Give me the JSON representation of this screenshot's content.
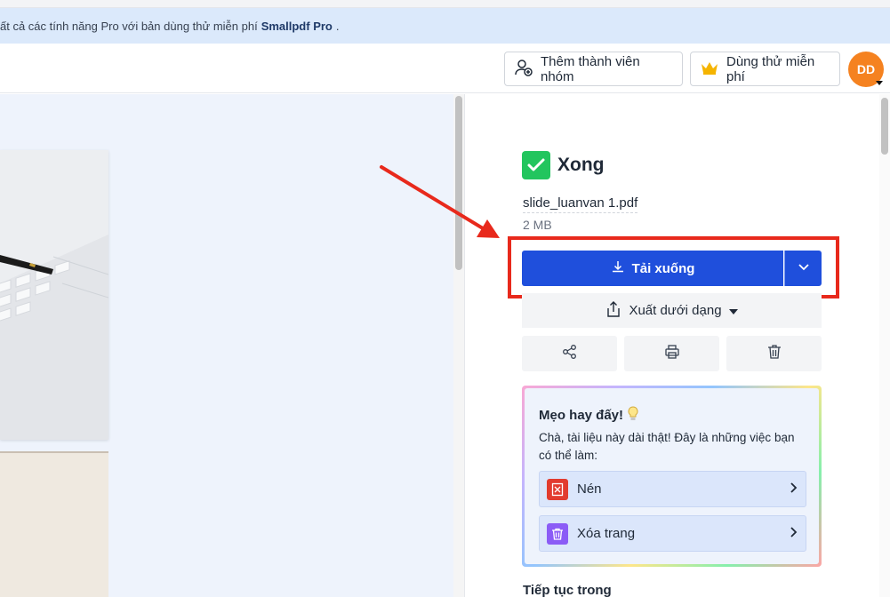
{
  "banner": {
    "text_prefix": "ất cả các tính năng Pro với bản dùng thử miễn phí",
    "brand": "Smallpdf Pro",
    "suffix": "."
  },
  "header": {
    "team_button": "Thêm thành viên nhóm",
    "trial_button": "Dùng thử miễn phí",
    "avatar_initials": "DD"
  },
  "result": {
    "status": "Xong",
    "file_name": "slide_luanvan 1.pdf",
    "file_size": "2 MB",
    "download_label": "Tải xuống",
    "export_label": "Xuất dưới dạng"
  },
  "tips": {
    "title": "Mẹo hay đấy!",
    "description": "Chà, tài liệu này dài thật! Đây là những việc bạn có thể làm:",
    "items": [
      {
        "label": "Nén",
        "icon": "compress-icon",
        "color": "#e23b2e"
      },
      {
        "label": "Xóa trang",
        "icon": "trash-icon",
        "color": "#8b5cf6"
      }
    ]
  },
  "continue_label": "Tiếp tục trong",
  "colors": {
    "primary": "#1f4fdc",
    "success": "#22c55e",
    "annotation": "#e8291c",
    "avatar": "#f58220"
  }
}
